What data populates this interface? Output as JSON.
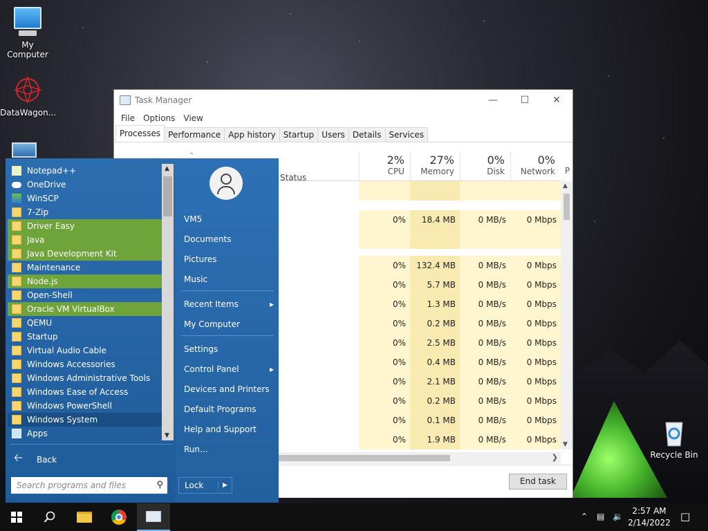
{
  "desktop": {
    "icons": [
      {
        "label": "My Computer"
      },
      {
        "label": "DataWagon..."
      },
      {
        "label": "Recycle Bin"
      }
    ]
  },
  "task_manager": {
    "title": "Task Manager",
    "menu": [
      "File",
      "Options",
      "View"
    ],
    "tabs": [
      "Processes",
      "Performance",
      "App history",
      "Startup",
      "Users",
      "Details",
      "Services"
    ],
    "active_tab": "Processes",
    "columns": {
      "status": "Status",
      "cpu": {
        "pct": "2%",
        "name": "CPU"
      },
      "memory": {
        "pct": "27%",
        "name": "Memory"
      },
      "disk": {
        "pct": "0%",
        "name": "Disk"
      },
      "network": {
        "pct": "0%",
        "name": "Network"
      },
      "power": "P"
    },
    "rows": [
      {
        "cpu": "",
        "mem": "",
        "disk": "",
        "net": ""
      },
      {
        "cpu": "0%",
        "mem": "18.4 MB",
        "disk": "0 MB/s",
        "net": "0 Mbps"
      },
      {
        "cpu": "",
        "mem": "",
        "disk": "",
        "net": ""
      },
      {
        "cpu": "0%",
        "mem": "132.4 MB",
        "disk": "0 MB/s",
        "net": "0 Mbps"
      },
      {
        "cpu": "0%",
        "mem": "5.7 MB",
        "disk": "0 MB/s",
        "net": "0 Mbps"
      },
      {
        "cpu": "0%",
        "mem": "1.3 MB",
        "disk": "0 MB/s",
        "net": "0 Mbps"
      },
      {
        "cpu": "0%",
        "mem": "0.2 MB",
        "disk": "0 MB/s",
        "net": "0 Mbps"
      },
      {
        "cpu": "0%",
        "mem": "2.5 MB",
        "disk": "0 MB/s",
        "net": "0 Mbps"
      },
      {
        "cpu": "0%",
        "mem": "0.4 MB",
        "disk": "0 MB/s",
        "net": "0 Mbps"
      },
      {
        "cpu": "0%",
        "mem": "2.1 MB",
        "disk": "0 MB/s",
        "net": "0 Mbps"
      },
      {
        "cpu": "0%",
        "mem": "0.2 MB",
        "disk": "0 MB/s",
        "net": "0 Mbps"
      },
      {
        "cpu": "0%",
        "mem": "0.1 MB",
        "disk": "0 MB/s",
        "net": "0 Mbps"
      },
      {
        "cpu": "0%",
        "mem": "1.9 MB",
        "disk": "0 MB/s",
        "net": "0 Mbps"
      }
    ],
    "end_task": "End task"
  },
  "start_menu": {
    "programs": [
      {
        "label": "Notepad++",
        "icon": "notepad-icon",
        "state": ""
      },
      {
        "label": "OneDrive",
        "icon": "cloud-icon",
        "state": ""
      },
      {
        "label": "WinSCP",
        "icon": "winscp-icon",
        "state": ""
      },
      {
        "label": "7-Zip",
        "icon": "folder-icon",
        "state": ""
      },
      {
        "label": "Driver Easy",
        "icon": "folder-icon",
        "state": "hl"
      },
      {
        "label": "Java",
        "icon": "folder-icon",
        "state": "hl"
      },
      {
        "label": "Java Development Kit",
        "icon": "folder-icon",
        "state": "hl"
      },
      {
        "label": "Maintenance",
        "icon": "folder-icon",
        "state": ""
      },
      {
        "label": "Node.js",
        "icon": "folder-icon",
        "state": "hl"
      },
      {
        "label": "Open-Shell",
        "icon": "folder-icon",
        "state": ""
      },
      {
        "label": "Oracle VM VirtualBox",
        "icon": "folder-icon",
        "state": "hl"
      },
      {
        "label": "QEMU",
        "icon": "folder-icon",
        "state": ""
      },
      {
        "label": "Startup",
        "icon": "folder-icon",
        "state": ""
      },
      {
        "label": "Virtual Audio Cable",
        "icon": "folder-icon",
        "state": ""
      },
      {
        "label": "Windows Accessories",
        "icon": "folder-icon",
        "state": ""
      },
      {
        "label": "Windows Administrative Tools",
        "icon": "folder-icon",
        "state": ""
      },
      {
        "label": "Windows Ease of Access",
        "icon": "folder-icon",
        "state": ""
      },
      {
        "label": "Windows PowerShell",
        "icon": "folder-icon",
        "state": ""
      },
      {
        "label": "Windows System",
        "icon": "folder-icon",
        "state": "sel"
      },
      {
        "label": "Apps",
        "icon": "apps-icon",
        "state": ""
      }
    ],
    "back": "Back",
    "search_placeholder": "Search programs and files",
    "right_items": [
      {
        "label": "VM5",
        "arrow": false
      },
      {
        "label": "Documents",
        "arrow": false
      },
      {
        "label": "Pictures",
        "arrow": false
      },
      {
        "label": "Music",
        "arrow": false
      },
      {
        "label": "Recent Items",
        "arrow": true
      },
      {
        "label": "My Computer",
        "arrow": false
      },
      {
        "label": "Settings",
        "arrow": false
      },
      {
        "label": "Control Panel",
        "arrow": true
      },
      {
        "label": "Devices and Printers",
        "arrow": false
      },
      {
        "label": "Default Programs",
        "arrow": false
      },
      {
        "label": "Help and Support",
        "arrow": false
      },
      {
        "label": "Run...",
        "arrow": false
      }
    ],
    "lock": "Lock"
  },
  "taskbar": {
    "time": "2:57 AM",
    "date": "2/14/2022"
  }
}
